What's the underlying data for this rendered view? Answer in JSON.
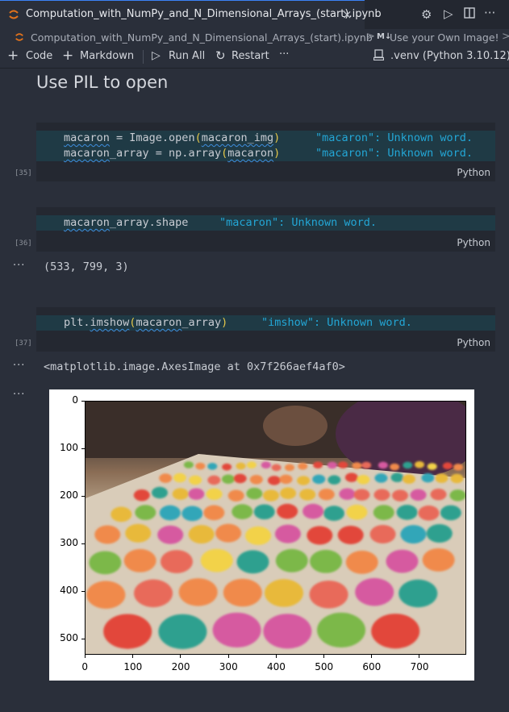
{
  "tab": {
    "title": "Computation_with_NumPy_and_N_Dimensional_Arrays_(start).ipynb",
    "close": "×"
  },
  "breadcrumb": {
    "file": "Computation_with_NumPy_and_N_Dimensional_Arrays_(start).ipynb",
    "sep": ">",
    "md_badge": "M↓",
    "section": "Use your Own Image!"
  },
  "toolbar": {
    "code_label": "Code",
    "markdown_label": "Markdown",
    "run_all_label": "Run All",
    "restart_label": "Restart",
    "more": "···",
    "kernel_label": ".venv (Python 3.10.12)"
  },
  "heading": "Use PIL to open",
  "cells": [
    {
      "count": "[35]",
      "lines": [
        {
          "prefix": "macaron",
          "rest1": " = Image.open",
          "p1": "(",
          "arg": "macaron_img",
          "p2": ")",
          "diag": "\"macaron\": Unknown word."
        },
        {
          "prefix": "macaron",
          "rest1": "_array = np.array",
          "p1": "(",
          "arg": "macaron",
          "p2": ")",
          "diag": "\"macaron\": Unknown word."
        }
      ],
      "lang": "Python"
    },
    {
      "count": "[36]",
      "line": {
        "prefix": "macaron",
        "rest": "_array.shape",
        "diag": "\"macaron\": Unknown word."
      },
      "lang": "Python",
      "output": "(533, 799, 3)"
    },
    {
      "count": "[37]",
      "line": {
        "pre": "plt.",
        "fn": "imshow",
        "p1": "(",
        "arg": "macaron",
        "rest": "_array",
        "p2": ")",
        "diag": "\"imshow\": Unknown word."
      },
      "lang": "Python",
      "output": "<matplotlib.image.AxesImage at 0x7f266aef4af0>"
    }
  ],
  "output_dots": "···",
  "plot": {
    "yticks": [
      "0",
      "100",
      "200",
      "300",
      "400",
      "500"
    ],
    "xticks": [
      "0",
      "100",
      "200",
      "300",
      "400",
      "500",
      "600",
      "700"
    ],
    "image_rows": 533,
    "image_cols": 799
  }
}
